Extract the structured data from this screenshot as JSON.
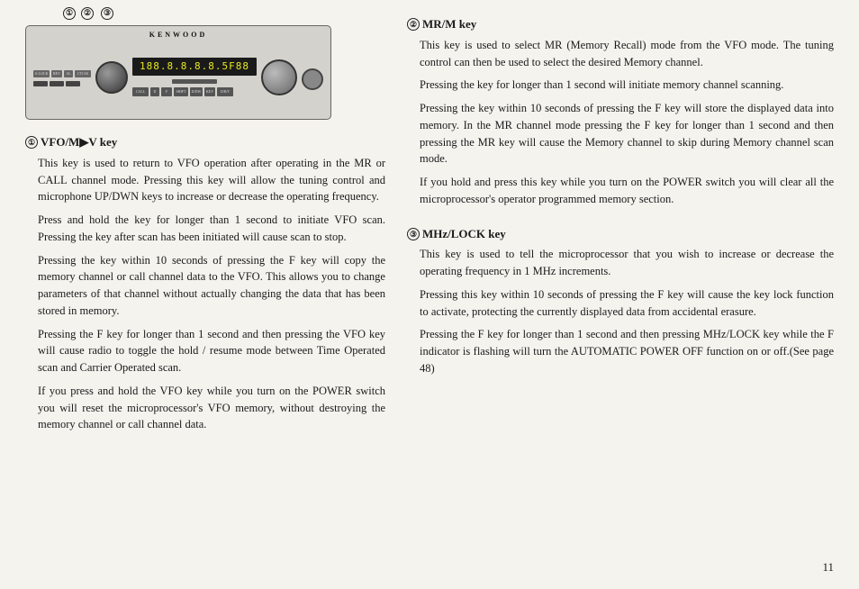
{
  "page": {
    "number": "11",
    "background": "#f5f3ee"
  },
  "device": {
    "brand": "KENWOOD",
    "display_text": "188.8.8.8.8.5F88",
    "annotation1": "①",
    "annotation2": "②",
    "annotation3": "③"
  },
  "section1": {
    "title": "① VFO/M▶V key",
    "circle": "①",
    "key_label": "VFO/M▶V key",
    "paragraphs": [
      "This key is used to return to VFO operation after operating in the MR or CALL channel mode. Pressing this key will allow the tuning control and microphone UP/DWN keys to increase or decrease the operating frequency.",
      "Press and hold the key for longer than 1 second to initiate VFO scan. Pressing the key after scan has been initiated will cause scan to stop.",
      "Pressing the key within 10 seconds of pressing the F key will copy the memory channel or call channel data to the VFO. This allows you to change parameters of that channel without actually changing the data that has been stored in memory.",
      "Pressing the F key for longer than 1 second and then pressing the VFO key will cause radio to toggle the hold / resume mode between Time Operated scan and Carrier Operated scan.",
      "If you press and hold the VFO key while you turn on the POWER switch you will reset the microprocessor's VFO memory, without destroying the memory channel or call channel data."
    ]
  },
  "section2": {
    "title": "② MR/M key",
    "circle": "②",
    "key_label": "MR/M key",
    "paragraphs": [
      "This key is used to select MR (Memory Recall) mode from the VFO mode. The tuning control can then be used to select the desired Memory channel.",
      "Pressing the key for longer than 1 second will initiate memory channel scanning.",
      "Pressing the key within 10 seconds of pressing the F key will store the displayed data into memory. In the MR channel mode pressing the F key for longer than 1 second and then pressing the MR key will cause the Memory channel to skip during Memory channel scan mode.",
      "If you hold and press this key while you turn on the POWER switch you will clear all the microprocessor's operator programmed memory section."
    ]
  },
  "section3": {
    "title": "③ MHz/LOCK key",
    "circle": "③",
    "key_label": "MHz/LOCK key",
    "paragraphs": [
      "This key is used to tell the microprocessor that you wish to increase or decrease the operating frequency in 1 MHz increments.",
      "Pressing this key within 10 seconds of pressing the F key will cause the key lock function to activate, protecting the currently displayed data from accidental erasure.",
      "Pressing the F key for longer than 1 second and then pressing MHz/LOCK key while the F indicator is flashing will turn the AUTOMATIC POWER OFF function on or off.(See page 48)"
    ]
  }
}
